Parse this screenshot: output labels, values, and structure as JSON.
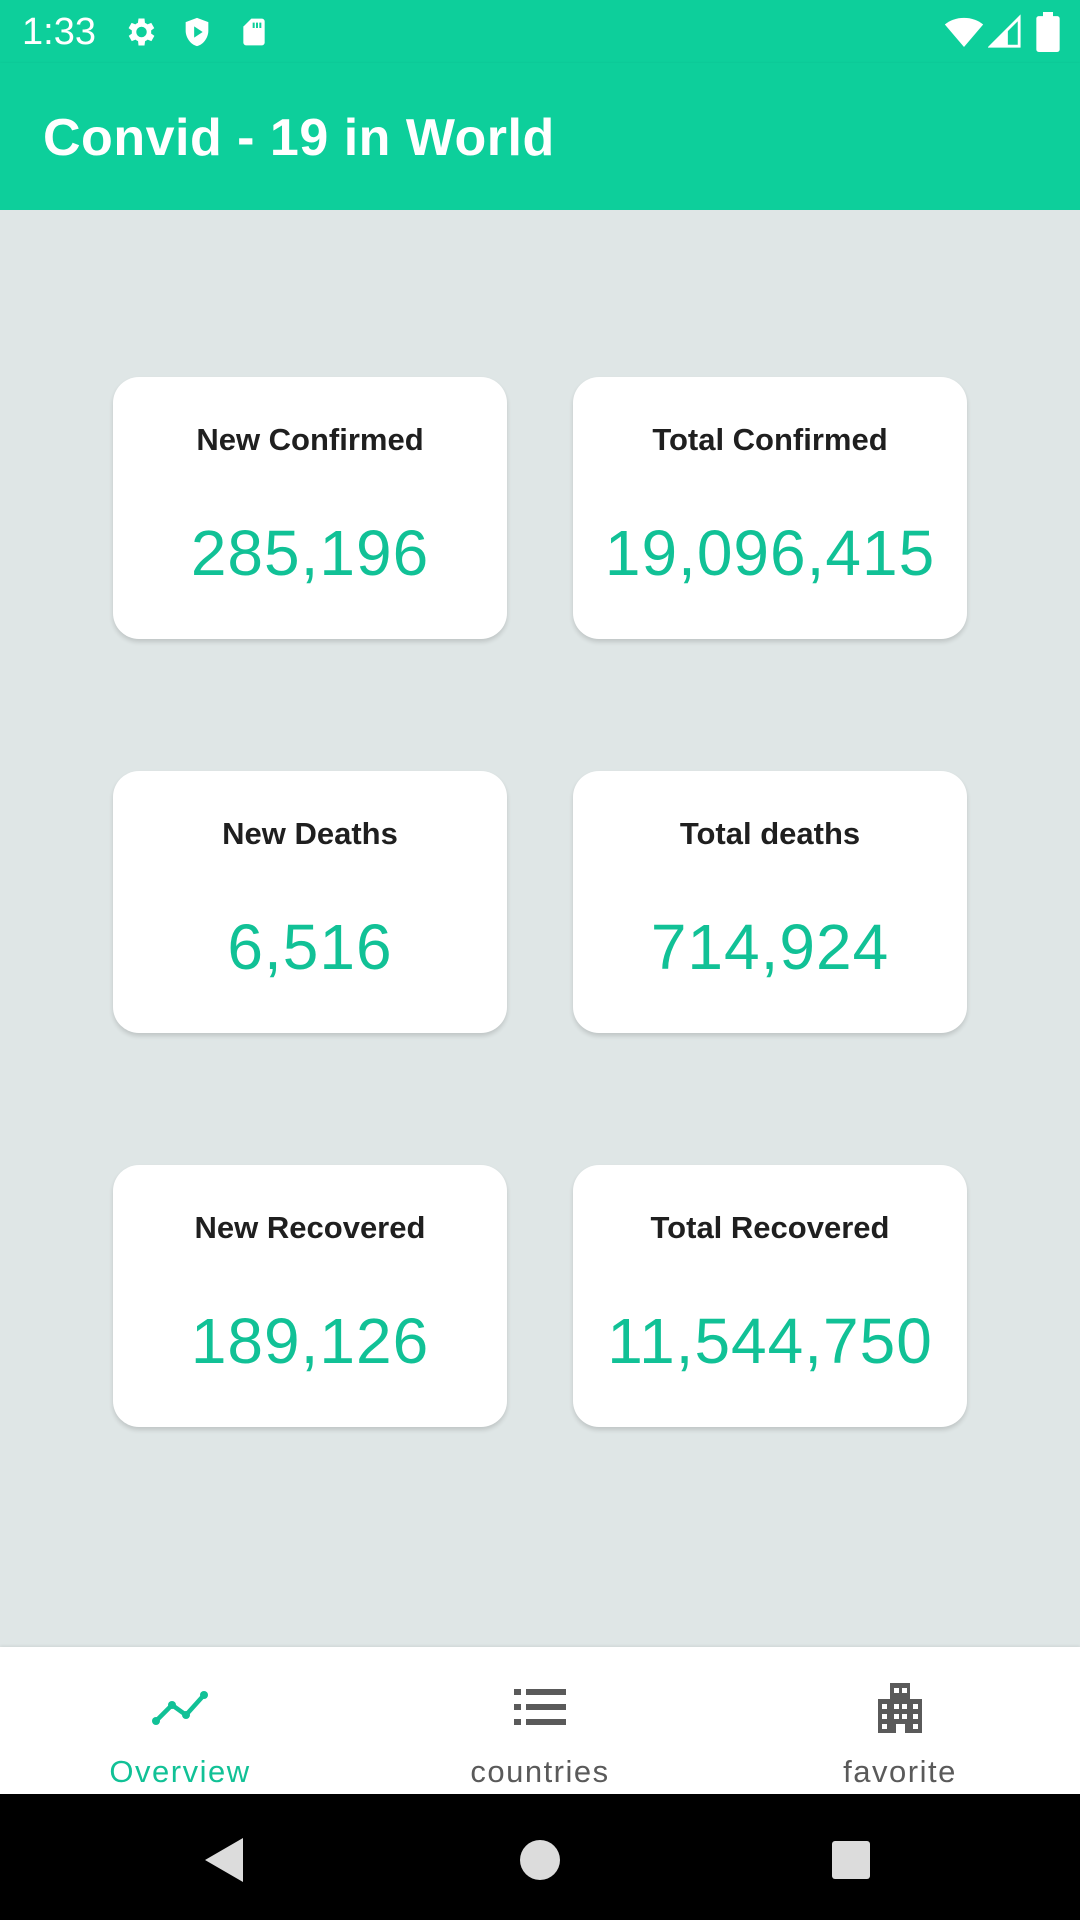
{
  "status_bar": {
    "time": "1:33",
    "icons": [
      "gear-icon",
      "shield-icon",
      "sd-card-icon",
      "wifi-icon",
      "signal-icon",
      "battery-icon"
    ]
  },
  "app_bar": {
    "title": "Convid - 19 in World"
  },
  "stats": [
    {
      "label": "New Confirmed",
      "value": "285,196"
    },
    {
      "label": "Total Confirmed",
      "value": "19,096,415"
    },
    {
      "label": "New Deaths",
      "value": "6,516"
    },
    {
      "label": "Total deaths",
      "value": "714,924"
    },
    {
      "label": "New Recovered",
      "value": "189,126"
    },
    {
      "label": "Total Recovered",
      "value": "11,544,750"
    }
  ],
  "bottom_nav": {
    "items": [
      {
        "label": "Overview",
        "icon": "trending-up-icon",
        "active": true
      },
      {
        "label": "countries",
        "icon": "list-icon",
        "active": false
      },
      {
        "label": "favorite",
        "icon": "building-icon",
        "active": false
      }
    ]
  },
  "system_nav": {
    "buttons": [
      "back-icon",
      "home-icon",
      "recents-icon"
    ]
  },
  "colors": {
    "accent": "#0dcf9b",
    "value_text": "#11c196",
    "background": "#dfe6e6",
    "nav_inactive": "#5a5a5a"
  }
}
